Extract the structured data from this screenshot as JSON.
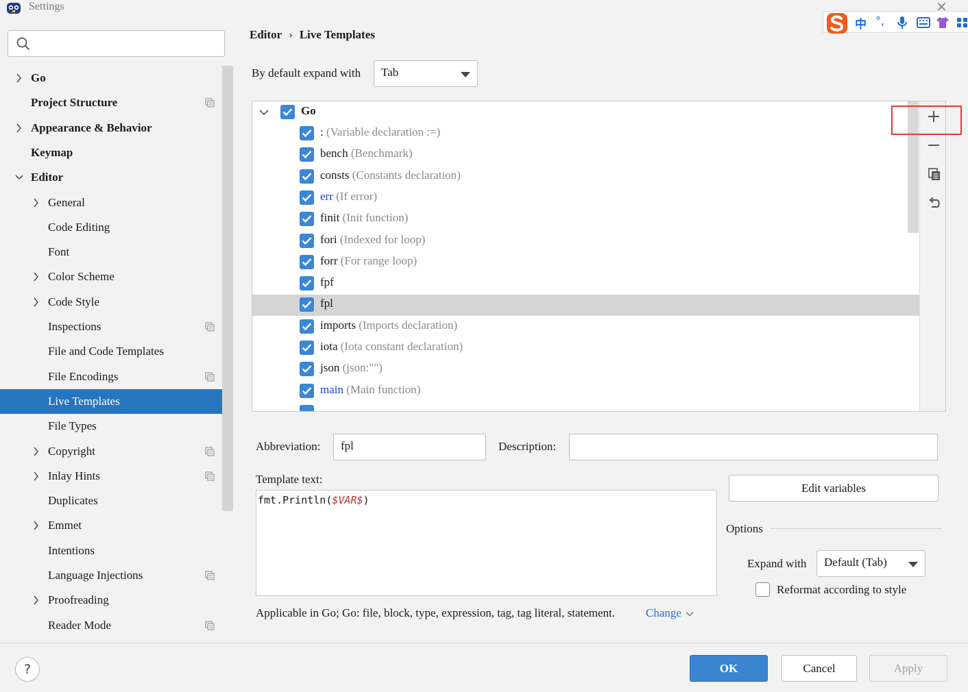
{
  "window": {
    "title": "Settings"
  },
  "ime": {
    "zh_label": "中"
  },
  "search": {
    "placeholder": ""
  },
  "sidebar": {
    "items": [
      {
        "label": "Go",
        "bold": true,
        "chevron": "right",
        "indent": 0,
        "project": false
      },
      {
        "label": "Project Structure",
        "bold": true,
        "chevron": "",
        "indent": 0,
        "project": true
      },
      {
        "label": "Appearance & Behavior",
        "bold": true,
        "chevron": "right",
        "indent": 0,
        "project": false
      },
      {
        "label": "Keymap",
        "bold": true,
        "chevron": "",
        "indent": 0,
        "project": false
      },
      {
        "label": "Editor",
        "bold": true,
        "chevron": "down",
        "indent": 0,
        "project": false
      },
      {
        "label": "General",
        "bold": false,
        "chevron": "right",
        "indent": 1,
        "project": false
      },
      {
        "label": "Code Editing",
        "bold": false,
        "chevron": "",
        "indent": 1,
        "project": false
      },
      {
        "label": "Font",
        "bold": false,
        "chevron": "",
        "indent": 1,
        "project": false
      },
      {
        "label": "Color Scheme",
        "bold": false,
        "chevron": "right",
        "indent": 1,
        "project": false
      },
      {
        "label": "Code Style",
        "bold": false,
        "chevron": "right",
        "indent": 1,
        "project": false
      },
      {
        "label": "Inspections",
        "bold": false,
        "chevron": "",
        "indent": 1,
        "project": true
      },
      {
        "label": "File and Code Templates",
        "bold": false,
        "chevron": "",
        "indent": 1,
        "project": false
      },
      {
        "label": "File Encodings",
        "bold": false,
        "chevron": "",
        "indent": 1,
        "project": true
      },
      {
        "label": "Live Templates",
        "bold": false,
        "chevron": "",
        "indent": 1,
        "project": false,
        "selected": true
      },
      {
        "label": "File Types",
        "bold": false,
        "chevron": "",
        "indent": 1,
        "project": false
      },
      {
        "label": "Copyright",
        "bold": false,
        "chevron": "right",
        "indent": 1,
        "project": true
      },
      {
        "label": "Inlay Hints",
        "bold": false,
        "chevron": "right",
        "indent": 1,
        "project": true
      },
      {
        "label": "Duplicates",
        "bold": false,
        "chevron": "",
        "indent": 1,
        "project": false
      },
      {
        "label": "Emmet",
        "bold": false,
        "chevron": "right",
        "indent": 1,
        "project": false
      },
      {
        "label": "Intentions",
        "bold": false,
        "chevron": "",
        "indent": 1,
        "project": false
      },
      {
        "label": "Language Injections",
        "bold": false,
        "chevron": "",
        "indent": 1,
        "project": true
      },
      {
        "label": "Proofreading",
        "bold": false,
        "chevron": "right",
        "indent": 1,
        "project": false
      },
      {
        "label": "Reader Mode",
        "bold": false,
        "chevron": "",
        "indent": 1,
        "project": true
      }
    ]
  },
  "breadcrumb": {
    "parent": "Editor",
    "current": "Live Templates"
  },
  "expand_default": {
    "label": "By default expand with",
    "value": "Tab"
  },
  "templates": {
    "group": "Go",
    "items": [
      {
        "abbr": ":",
        "desc": "(Variable declaration :=)",
        "blue": false
      },
      {
        "abbr": "bench",
        "desc": "(Benchmark)",
        "blue": false
      },
      {
        "abbr": "consts",
        "desc": "(Constants declaration)",
        "blue": false
      },
      {
        "abbr": "err",
        "desc": "(If error)",
        "blue": true
      },
      {
        "abbr": "finit",
        "desc": "(Init function)",
        "blue": false
      },
      {
        "abbr": "fori",
        "desc": "(Indexed for loop)",
        "blue": false
      },
      {
        "abbr": "forr",
        "desc": "(For range loop)",
        "blue": false
      },
      {
        "abbr": "fpf",
        "desc": "",
        "blue": false
      },
      {
        "abbr": "fpl",
        "desc": "",
        "blue": false,
        "selected": true
      },
      {
        "abbr": "imports",
        "desc": "(Imports declaration)",
        "blue": false
      },
      {
        "abbr": "iota",
        "desc": "(Iota constant declaration)",
        "blue": false
      },
      {
        "abbr": "json",
        "desc": "(json:\"\")",
        "blue": false
      },
      {
        "abbr": "main",
        "desc": "(Main function)",
        "blue": true
      }
    ]
  },
  "details": {
    "abbreviation_label": "Abbreviation:",
    "abbreviation_value": "fpl",
    "description_label": "Description:",
    "description_value": "",
    "template_text_label": "Template text:",
    "template_code_prefix": "fmt.Println(",
    "template_code_var": "$VAR$",
    "template_code_suffix": ")",
    "edit_variables": "Edit variables",
    "options_label": "Options",
    "expand_with_label": "Expand with",
    "expand_with_value": "Default (Tab)",
    "reformat_label": "Reformat according to style",
    "applicable_text": "Applicable in Go; Go: file, block, type, expression, tag, tag literal, statement.",
    "change_link": "Change"
  },
  "footer": {
    "help": "?",
    "ok": "OK",
    "cancel": "Cancel",
    "apply": "Apply"
  },
  "colors": {
    "accent": "#2675bf",
    "checkbox": "#3a87d6",
    "highlight_box": "#e53935"
  }
}
